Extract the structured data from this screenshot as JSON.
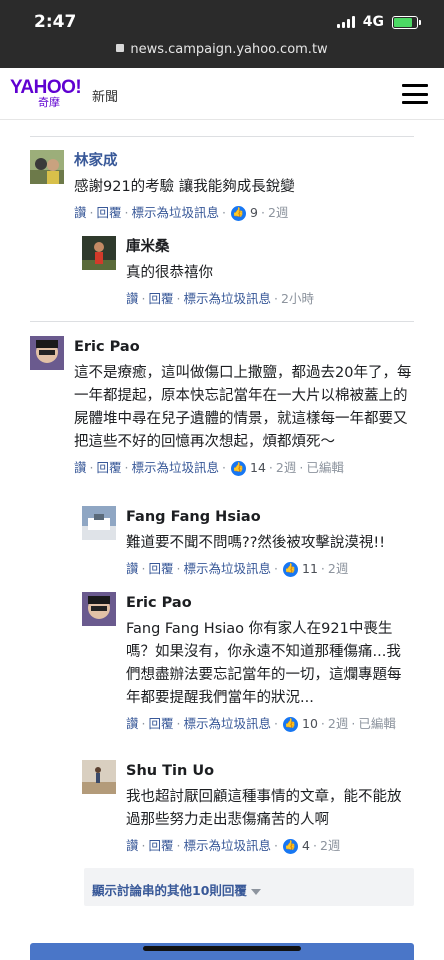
{
  "status_bar": {
    "time": "2:47",
    "network": "4G",
    "battery_percent": 80
  },
  "browser": {
    "url": "news.campaign.yahoo.com.tw"
  },
  "header": {
    "logo_main": "YAHOO!",
    "logo_sub": "奇摩",
    "section": "新聞"
  },
  "colors": {
    "link": "#385898",
    "like": "#1877f2",
    "meta": "#8d949e",
    "logo": "#5f01d1"
  },
  "action_labels": {
    "like": "讚",
    "reply": "回覆",
    "spam": "標示為垃圾訊息",
    "edited": "已編輯"
  },
  "comments": [
    {
      "name": "林家成",
      "text": "感謝921的考驗 讓我能夠成長銳變",
      "likes": "9",
      "time": "2週",
      "avatar": "photo-avatar",
      "replies": [
        {
          "name": "庫米桑",
          "text": "真的很恭禧你",
          "likes": "",
          "time": "2小時",
          "avatar": "photo-avatar"
        }
      ]
    },
    {
      "name": "Eric Pao",
      "text": "這不是療癒，這叫做傷口上撒鹽，都過去20年了，每一年都提起，原本快忘記當年在一大片以棉被蓋上的屍體堆中尋在兒子遺體的情景，就這樣每一年都要又把這些不好的回憶再次想起，煩都煩死～",
      "likes": "14",
      "time": "2週",
      "edited": true,
      "avatar": "photo-avatar",
      "replies": [
        {
          "name": "Fang Fang Hsiao",
          "text": "難道要不聞不問嗎??然後被攻擊說漠視!!",
          "likes": "11",
          "time": "2週",
          "avatar": "photo-avatar"
        },
        {
          "name": "Eric Pao",
          "text": "Fang Fang Hsiao 你有家人在921中喪生嗎？如果沒有，你永遠不知道那種傷痛...我們想盡辦法要忘記當年的一切，這爛專題每年都要提醒我們當年的狀況...",
          "likes": "10",
          "time": "2週",
          "edited": true,
          "avatar": "photo-avatar"
        },
        {
          "name": "Shu Tin Uo",
          "text": "我也超討厭回顧這種事情的文章，能不能放過那些努力走出悲傷痛苦的人啊",
          "likes": "4",
          "time": "2週",
          "avatar": "photo-avatar"
        }
      ],
      "more_replies": "顯示討論串的其他10則回覆"
    }
  ]
}
